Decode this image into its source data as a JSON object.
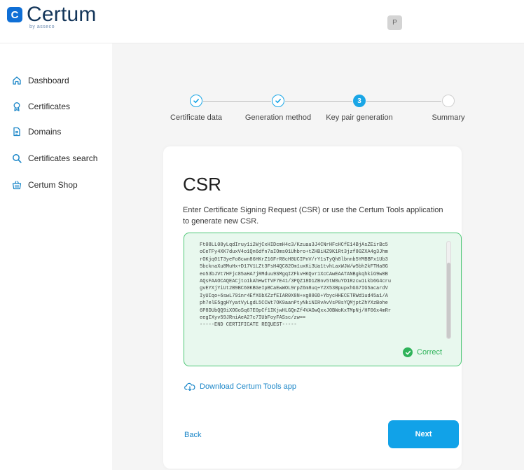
{
  "header": {
    "logo_badge": "C",
    "logo_text": "Certum",
    "logo_sub": "by asseco",
    "avatar_initial": "P"
  },
  "sidebar": {
    "items": [
      {
        "label": "Dashboard",
        "icon": "home-icon"
      },
      {
        "label": "Certificates",
        "icon": "award-icon"
      },
      {
        "label": "Domains",
        "icon": "document-icon"
      },
      {
        "label": "Certificates search",
        "icon": "search-icon"
      },
      {
        "label": "Certum Shop",
        "icon": "cart-icon"
      }
    ]
  },
  "stepper": {
    "steps": [
      {
        "label": "Certificate data",
        "state": "done"
      },
      {
        "label": "Generation method",
        "state": "done"
      },
      {
        "label": "Key pair generation",
        "state": "active",
        "number": "3"
      },
      {
        "label": "Summary",
        "state": "todo"
      }
    ]
  },
  "card": {
    "title": "CSR",
    "description": "Enter Certificate Signing Request (CSR) or use the Certum Tools application to generate new CSR.",
    "csr_text": "Ft08LL08yLqdIruy1i2WjCxHIDcmH4c3/Kzuau3J4CNrHFcHCfE14BjAsZEirBc5\noCeTFy4XK7duxV4o1Qn6dfn7aIOms01Uhbro+tZHBiHZ9K1Rt3jzf80ZXA4g3Jhm\nrOKjq01T3yeFo8cwn86HKrZ16FrR8cH0UCIPnV/rY1sTyQh8lbnnb5YMBBFx1Ub3\n5bcknaXu8MuHx+D17V1LZt3FsH4QC82Om1uxKi3Ua1tvhLaxWJW/w5bh2kFTHa8G\neo53bJVt7HFjc85aHA7jRMduu9SMgqIZFkvHKQvr1XcCAwEAATANBgkqhkiG9w0B\nAQsFAAOCAQEACjto1kAhHwITVF7E41/3PQZ18D1ZBnv5tW8uYD1Rzcw1Lkb6G4cru\ngvEYXjYiUt2B9BC60KBGeIpBCaEwWOL9rpZ6m8uq+Y2X53BpupxhGG7IG5acardV\nIyUIqo+6swL791nr4EfX6bXZzfEIAR0X8N+xg880D+YbycHHECETRWd1ud45a1/A\nph7elE5ggHYyatVyLgdL5CCWt7OK9aanPtyNkiNIRvAvVsP8sYQMjptZhYXzBohe\n6P8DUbQQ9iXOGoSq67E0pCf1IKjwHLGQnZf4VAOwQxxJ0BWoKxTMpNj/HF06x4mRr\neegIXyv59JRniAeA27c7IUbFoyFASsc/zw==\n-----END CERTIFICATE REQUEST-----",
    "status_text": "Correct",
    "download_label": "Download Certum Tools app",
    "back_label": "Back",
    "next_label": "Next"
  },
  "colors": {
    "accent": "#11a2e8",
    "success": "#2fb35a",
    "success_bg": "#e8f8ee",
    "logo_badge": "#0f6fd6",
    "logo_text": "#14365a"
  }
}
